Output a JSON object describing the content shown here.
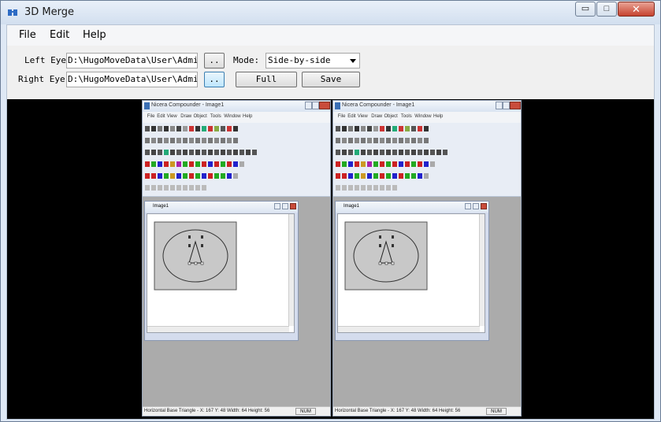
{
  "window": {
    "title": "3D Merge",
    "min": "▭",
    "max": "□",
    "close": "✕"
  },
  "menu": [
    {
      "label": "File"
    },
    {
      "label": "Edit"
    },
    {
      "label": "Help"
    }
  ],
  "left_eye": {
    "label": "Left Eye:",
    "value": "D:\\HugoMoveData\\User\\Admini",
    "browse": ".."
  },
  "right_eye": {
    "label": "Right Eye:",
    "value": "D:\\HugoMoveData\\User\\Admini",
    "browse": ".."
  },
  "mode": {
    "label": "Mode:",
    "selected": "Side-by-side"
  },
  "buttons": {
    "full": "Full",
    "save": "Save"
  },
  "preview": {
    "app_title": "Nicera Compounder - Image1",
    "menu": [
      "File",
      "Edit",
      "View",
      "Draw",
      "Object",
      "Tools",
      "Window",
      "Help"
    ],
    "child_title": "Image1",
    "status": "Horizontal Base Triangle - X: 167  Y: 48  Width: 64  Height: 56",
    "num": "NUM"
  },
  "colors": {
    "accent": "#3c7fb1",
    "viewer_bg": "#000000",
    "close": "#c6432f"
  }
}
